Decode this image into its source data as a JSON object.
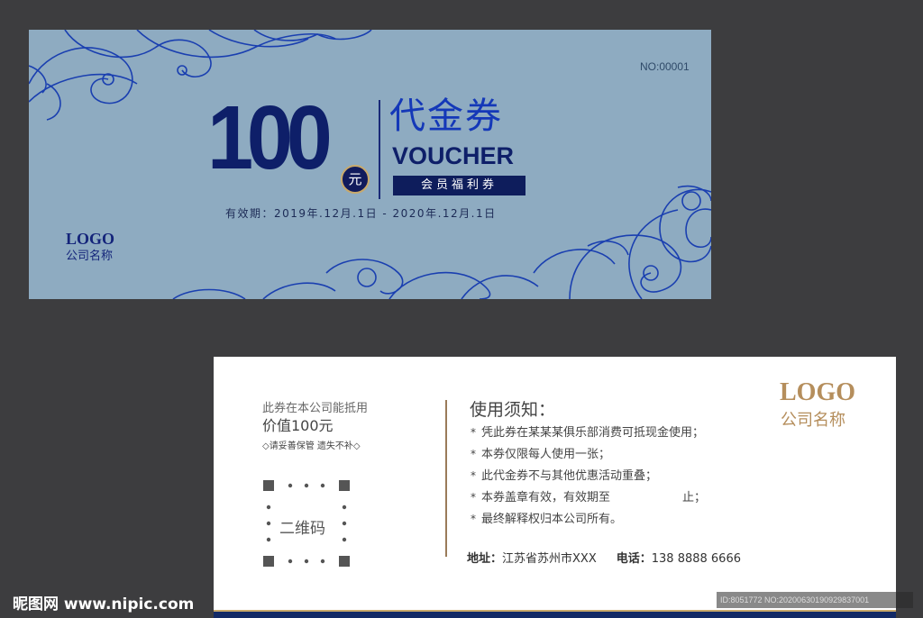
{
  "front": {
    "serial": "NO:00001",
    "amount": "100",
    "unit": "元",
    "title_cn": "代金券",
    "title_en": "VOUCHER",
    "welfare_label": "会员福利券",
    "validity": "有效期：2019年.12月.1日 - 2020年.12月.1日",
    "logo": "LOGO",
    "company": "公司名称"
  },
  "back": {
    "line1": "此券在本公司能抵用",
    "line2": "价值100元",
    "note": "◇请妥善保管 遗失不补◇",
    "qr_label": "二维码",
    "notice_title": "使用须知：",
    "rules": [
      "凭此券在某某某俱乐部消费可抵现金使用；",
      "本券仅限每人使用一张；",
      "此代金券不与其他优惠活动重叠；",
      "本券盖章有效，有效期至",
      "最终解释权归本公司所有。"
    ],
    "rule4_tail": "止；",
    "bullet": "*",
    "address_label": "地址：",
    "address": "江苏省苏州市XXX",
    "phone_label": "电话：",
    "phone": "138 8888 6666",
    "logo": "LOGO",
    "company": "公司名称"
  },
  "watermark": {
    "site": "昵图网 www.nipic.com",
    "id": "ID:8051772 NO:20200630190929837001"
  },
  "colors": {
    "front_bg": "#8eabc1",
    "navy": "#0e1f69",
    "blue": "#1438b8",
    "gold": "#b58e5c"
  }
}
